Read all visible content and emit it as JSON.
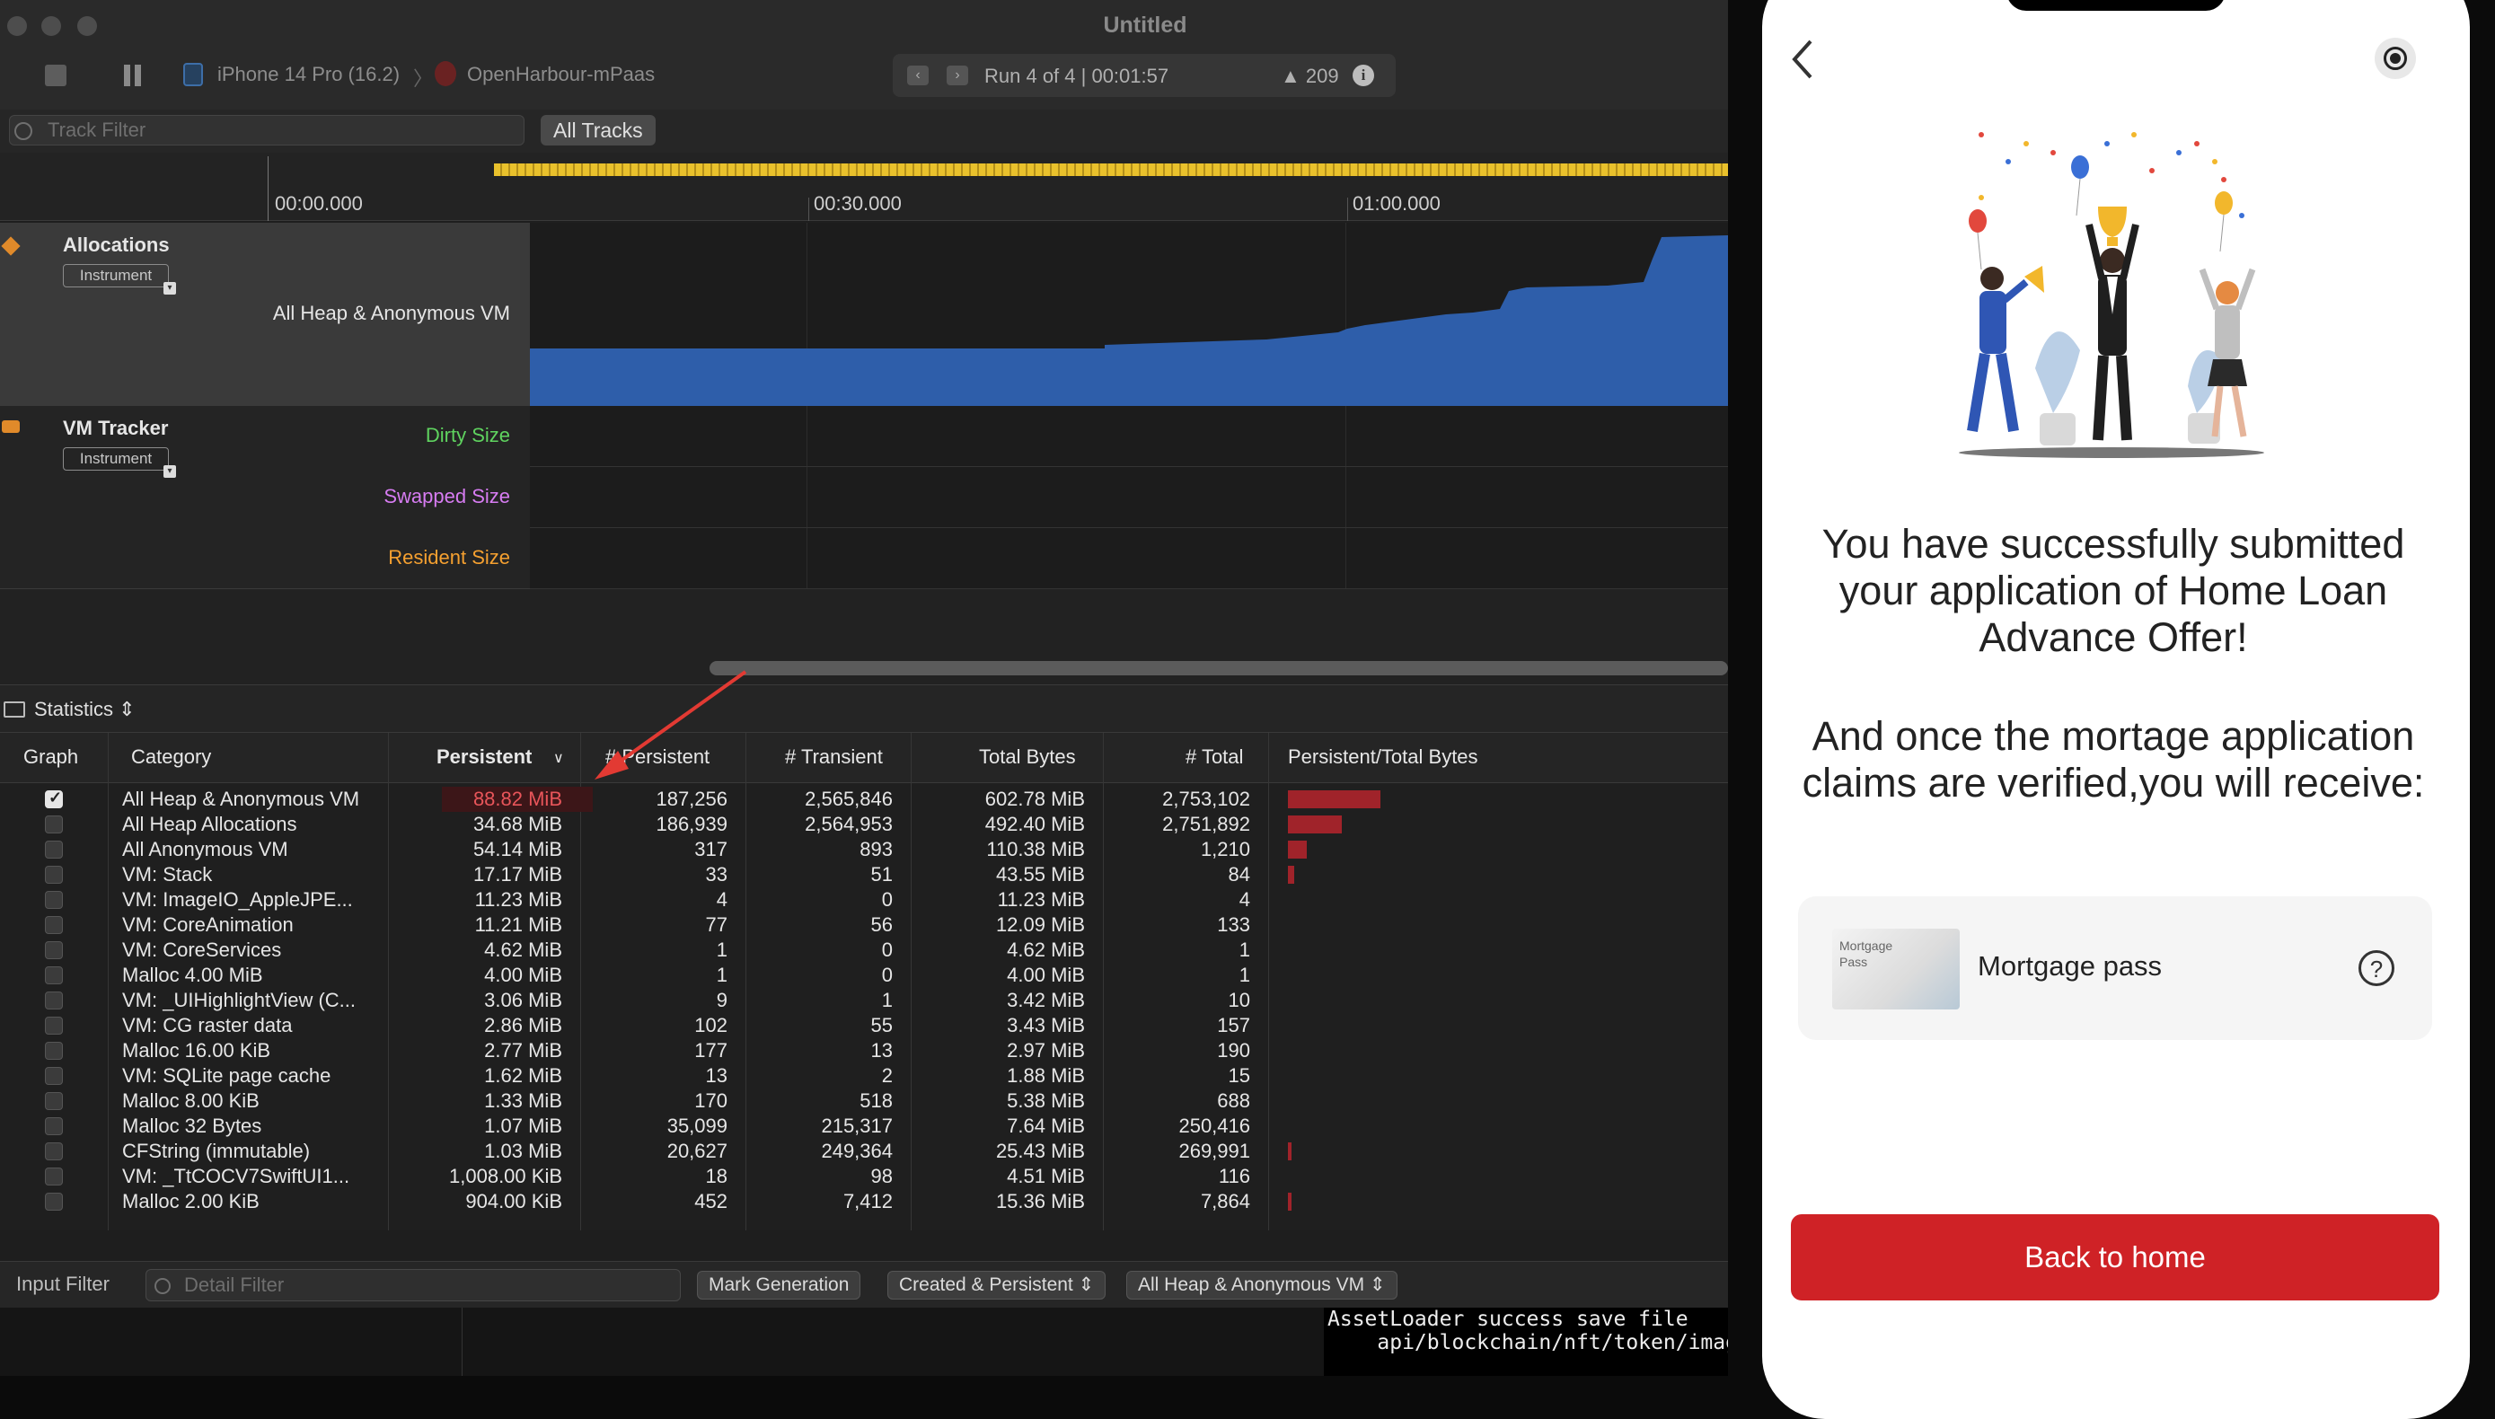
{
  "window": {
    "title": "Untitled"
  },
  "toolbar": {
    "device": "iPhone 14 Pro (16.2)",
    "app": "OpenHarbour-mPaas",
    "run_status": "Run 4 of 4  |  00:01:57",
    "warning_count": "209",
    "info_icon": "i"
  },
  "filter": {
    "track_placeholder": "Track Filter",
    "all_tracks": "All Tracks"
  },
  "timeline": {
    "ticks": [
      "00:00.000",
      "00:30.000",
      "01:00.000"
    ]
  },
  "tracks": {
    "allocations": {
      "name": "Allocations",
      "badge": "Instrument",
      "label": "All Heap & Anonymous VM"
    },
    "vm_tracker": {
      "name": "VM Tracker",
      "badge": "Instrument",
      "labels": {
        "dirty": "Dirty Size",
        "swapped": "Swapped Size",
        "resident": "Resident Size"
      }
    }
  },
  "stats": {
    "view_label": "Statistics"
  },
  "table": {
    "headers": {
      "graph": "Graph",
      "category": "Category",
      "persistent": "Persistent",
      "n_persistent": "# Persistent",
      "n_transient": "# Transient",
      "total_bytes": "Total Bytes",
      "n_total": "# Total",
      "ratio": "Persistent/Total Bytes"
    },
    "rows": [
      {
        "checked": true,
        "category": "All Heap & Anonymous VM",
        "persistent": "88.82 MiB",
        "n_persistent": "187,256",
        "n_transient": "2,565,846",
        "total_bytes": "602.78 MiB",
        "n_total": "2,753,102",
        "ratio": 0.147
      },
      {
        "checked": false,
        "category": "All Heap Allocations",
        "persistent": "34.68 MiB",
        "n_persistent": "186,939",
        "n_transient": "2,564,953",
        "total_bytes": "492.40 MiB",
        "n_total": "2,751,892",
        "ratio": 0.085
      },
      {
        "checked": false,
        "category": "All Anonymous VM",
        "persistent": "54.14 MiB",
        "n_persistent": "317",
        "n_transient": "893",
        "total_bytes": "110.38 MiB",
        "n_total": "1,210",
        "ratio": 0.03
      },
      {
        "checked": false,
        "category": "VM: Stack",
        "persistent": "17.17 MiB",
        "n_persistent": "33",
        "n_transient": "51",
        "total_bytes": "43.55 MiB",
        "n_total": "84",
        "ratio": 0.01
      },
      {
        "checked": false,
        "category": "VM: ImageIO_AppleJPE...",
        "persistent": "11.23 MiB",
        "n_persistent": "4",
        "n_transient": "0",
        "total_bytes": "11.23 MiB",
        "n_total": "4",
        "ratio": 0
      },
      {
        "checked": false,
        "category": "VM: CoreAnimation",
        "persistent": "11.21 MiB",
        "n_persistent": "77",
        "n_transient": "56",
        "total_bytes": "12.09 MiB",
        "n_total": "133",
        "ratio": 0
      },
      {
        "checked": false,
        "category": "VM: CoreServices",
        "persistent": "4.62 MiB",
        "n_persistent": "1",
        "n_transient": "0",
        "total_bytes": "4.62 MiB",
        "n_total": "1",
        "ratio": 0
      },
      {
        "checked": false,
        "category": "Malloc 4.00 MiB",
        "persistent": "4.00 MiB",
        "n_persistent": "1",
        "n_transient": "0",
        "total_bytes": "4.00 MiB",
        "n_total": "1",
        "ratio": 0
      },
      {
        "checked": false,
        "category": "VM: _UIHighlightView (C...",
        "persistent": "3.06 MiB",
        "n_persistent": "9",
        "n_transient": "1",
        "total_bytes": "3.42 MiB",
        "n_total": "10",
        "ratio": 0
      },
      {
        "checked": false,
        "category": "VM: CG raster data",
        "persistent": "2.86 MiB",
        "n_persistent": "102",
        "n_transient": "55",
        "total_bytes": "3.43 MiB",
        "n_total": "157",
        "ratio": 0
      },
      {
        "checked": false,
        "category": "Malloc 16.00 KiB",
        "persistent": "2.77 MiB",
        "n_persistent": "177",
        "n_transient": "13",
        "total_bytes": "2.97 MiB",
        "n_total": "190",
        "ratio": 0
      },
      {
        "checked": false,
        "category": "VM: SQLite page cache",
        "persistent": "1.62 MiB",
        "n_persistent": "13",
        "n_transient": "2",
        "total_bytes": "1.88 MiB",
        "n_total": "15",
        "ratio": 0
      },
      {
        "checked": false,
        "category": "Malloc 8.00 KiB",
        "persistent": "1.33 MiB",
        "n_persistent": "170",
        "n_transient": "518",
        "total_bytes": "5.38 MiB",
        "n_total": "688",
        "ratio": 0
      },
      {
        "checked": false,
        "category": "Malloc 32 Bytes",
        "persistent": "1.07 MiB",
        "n_persistent": "35,099",
        "n_transient": "215,317",
        "total_bytes": "7.64 MiB",
        "n_total": "250,416",
        "ratio": 0
      },
      {
        "checked": false,
        "category": "CFString (immutable)",
        "persistent": "1.03 MiB",
        "n_persistent": "20,627",
        "n_transient": "249,364",
        "total_bytes": "25.43 MiB",
        "n_total": "269,991",
        "ratio": 0.003
      },
      {
        "checked": false,
        "category": "VM: _TtCOCV7SwiftUI1...",
        "persistent": "1,008.00 KiB",
        "n_persistent": "18",
        "n_transient": "98",
        "total_bytes": "4.51 MiB",
        "n_total": "116",
        "ratio": 0
      },
      {
        "checked": false,
        "category": "Malloc 2.00 KiB",
        "persistent": "904.00 KiB",
        "n_persistent": "452",
        "n_transient": "7,412",
        "total_bytes": "15.36 MiB",
        "n_total": "7,864",
        "ratio": 0.003
      }
    ]
  },
  "bottom": {
    "input_filter": "Input Filter",
    "detail_placeholder": "Detail Filter",
    "mark_generation": "Mark Generation",
    "mode": "Created & Persistent",
    "scope": "All Heap & Anonymous VM"
  },
  "console": {
    "lines": [
      "AssetLoader success save file",
      "    api/blockchain/nft/token/imag"
    ]
  },
  "phone": {
    "message1": "You have successfully submitted your application of Home Loan Advance Offer!",
    "message2": "And once the mortage application claims are verified,you will receive:",
    "card_thumb_text": "Mortgage Pass",
    "card_title": "Mortgage pass",
    "help_icon": "?",
    "back_button": "Back to home"
  },
  "colors": {
    "accent_red": "#CF2226",
    "alloc_blue": "#2E5EAA",
    "dirty": "#5FD35F",
    "swapped": "#D77CF2",
    "resident": "#F5A030",
    "highlight": "#E8555A"
  }
}
